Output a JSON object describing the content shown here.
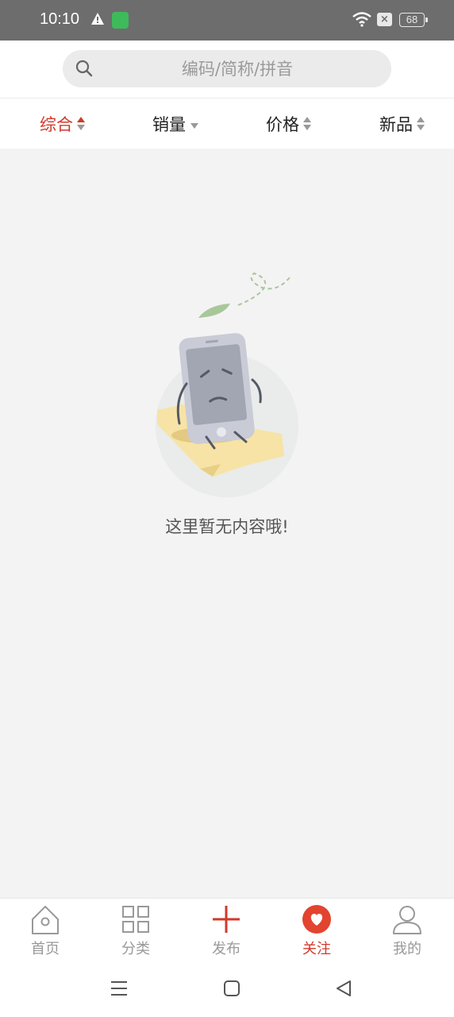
{
  "status_bar": {
    "time": "10:10",
    "battery": "68",
    "close_glyph": "×"
  },
  "search": {
    "placeholder": "编码/简称/拼音"
  },
  "sort_tabs": [
    {
      "label": "综合",
      "active": true
    },
    {
      "label": "销量"
    },
    {
      "label": "价格"
    },
    {
      "label": "新品"
    }
  ],
  "empty_state": {
    "message": "这里暂无内容哦!"
  },
  "bottom_nav": [
    {
      "label": "首页",
      "icon": "home-icon"
    },
    {
      "label": "分类",
      "icon": "grid-icon"
    },
    {
      "label": "发布",
      "icon": "plus-icon"
    },
    {
      "label": "关注",
      "icon": "heart-icon",
      "active": true
    },
    {
      "label": "我的",
      "icon": "person-icon"
    }
  ],
  "colors": {
    "accent": "#d03a2a",
    "background": "#f3f3f3",
    "status_bar": "#6d6d6d"
  }
}
